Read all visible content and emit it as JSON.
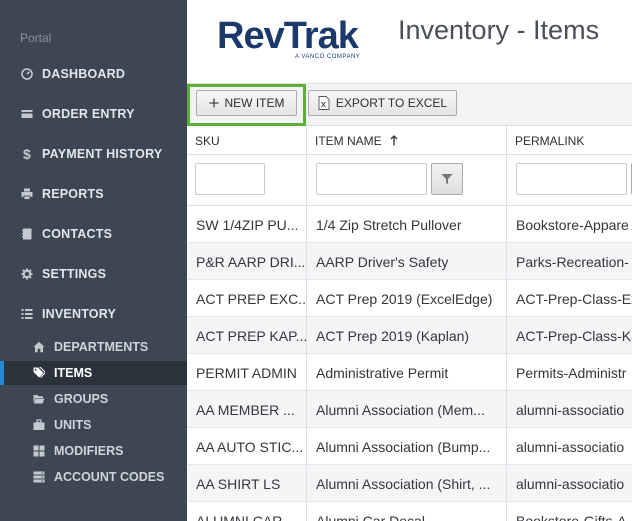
{
  "sidebar": {
    "portal_label": "Portal",
    "nav": [
      {
        "label": "DASHBOARD",
        "icon": "dashboard-icon"
      },
      {
        "label": "ORDER ENTRY",
        "icon": "order-entry-icon"
      },
      {
        "label": "PAYMENT HISTORY",
        "icon": "dollar-icon"
      },
      {
        "label": "REPORTS",
        "icon": "printer-icon"
      },
      {
        "label": "CONTACTS",
        "icon": "contacts-book-icon"
      },
      {
        "label": "SETTINGS",
        "icon": "gear-icon"
      },
      {
        "label": "INVENTORY",
        "icon": "list-icon"
      }
    ],
    "inventory_sub": [
      {
        "label": "DEPARTMENTS",
        "icon": "home-icon"
      },
      {
        "label": "ITEMS",
        "icon": "tags-icon",
        "active": true
      },
      {
        "label": "GROUPS",
        "icon": "folder-open-icon"
      },
      {
        "label": "UNITS",
        "icon": "briefcase-icon"
      },
      {
        "label": "MODIFIERS",
        "icon": "modifiers-icon"
      },
      {
        "label": "ACCOUNT CODES",
        "icon": "server-icon"
      }
    ]
  },
  "header": {
    "logo_text": "RevTrak",
    "logo_subtitle": "A VANCO COMPANY",
    "page_title": "Inventory - Items"
  },
  "toolbar": {
    "new_item_label": "NEW ITEM",
    "export_label": "EXPORT TO EXCEL"
  },
  "grid": {
    "columns": [
      {
        "label": "SKU"
      },
      {
        "label": "ITEM NAME",
        "sort": "ascending"
      },
      {
        "label": "PERMALINK"
      }
    ],
    "rows": [
      {
        "sku": "SW 1/4ZIP PU...",
        "name": "1/4 Zip Stretch Pullover",
        "permalink": "Bookstore-Appare"
      },
      {
        "sku": "P&R AARP DRI...",
        "name": "AARP Driver's Safety",
        "permalink": "Parks-Recreation-"
      },
      {
        "sku": "ACT PREP EXC...",
        "name": "ACT Prep 2019 (ExcelEdge)",
        "permalink": "ACT-Prep-Class-Ex"
      },
      {
        "sku": "ACT PREP KAP...",
        "name": "ACT Prep 2019 (Kaplan)",
        "permalink": "ACT-Prep-Class-Ka"
      },
      {
        "sku": "PERMIT ADMIN",
        "name": "Administrative Permit",
        "permalink": "Permits-Administr"
      },
      {
        "sku": "AA MEMBER ...",
        "name": "Alumni Association (Mem...",
        "permalink": "alumni-associatio"
      },
      {
        "sku": "AA AUTO STIC...",
        "name": "Alumni Association (Bump...",
        "permalink": "alumni-associatio"
      },
      {
        "sku": "AA SHIRT LS",
        "name": "Alumni Association (Shirt, ...",
        "permalink": "alumni-associatio"
      },
      {
        "sku": "ALUMNI CAR...",
        "name": "Alumni Car Decal",
        "permalink": "Bookstore-Gifts-A"
      }
    ]
  },
  "colors": {
    "sidebar_bg": "#3f4653",
    "active_accent": "#1f8ad6",
    "highlight_border": "#5cb03a",
    "logo_blue": "#1b3a6b"
  }
}
